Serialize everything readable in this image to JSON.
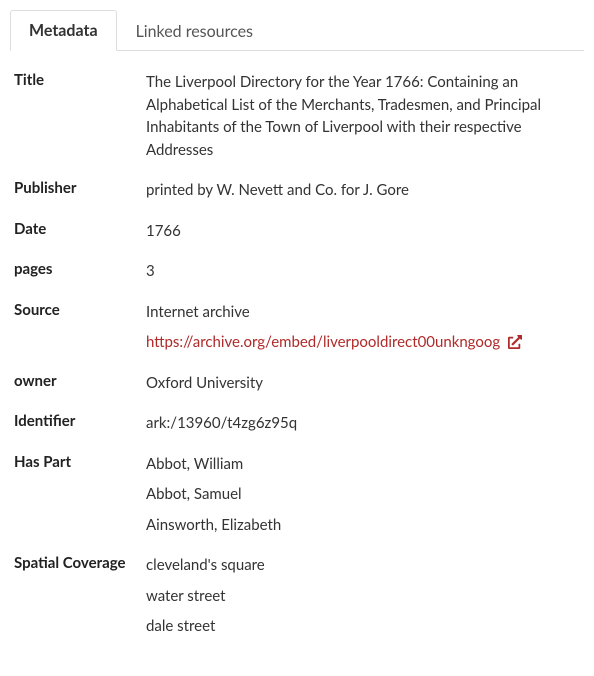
{
  "tabs": {
    "metadata_label": "Metadata",
    "linked_label": "Linked resources"
  },
  "labels": {
    "title": "Title",
    "publisher": "Publisher",
    "date": "Date",
    "pages": "pages",
    "source": "Source",
    "owner": "owner",
    "identifier": "Identifier",
    "has_part": "Has Part",
    "spatial": "Spatial Coverage"
  },
  "values": {
    "title": "The Liverpool Directory for the Year 1766: Containing an Alphabetical List of the Merchants, Tradesmen, and Principal Inhabitants of the Town of Liverpool with their respective Addresses",
    "publisher": "printed by W. Nevett and Co. for J. Gore",
    "date": "1766",
    "pages": "3",
    "source_name": "Internet archive",
    "source_url": "https://archive.org/embed/liverpooldirect00unkngoog",
    "owner": "Oxford University",
    "identifier": "ark:/13960/t4zg6z95q",
    "has_part": [
      "Abbot, William",
      "Abbot, Samuel",
      "Ainsworth, Elizabeth"
    ],
    "spatial": [
      "cleveland's square",
      "water street",
      "dale street"
    ]
  }
}
